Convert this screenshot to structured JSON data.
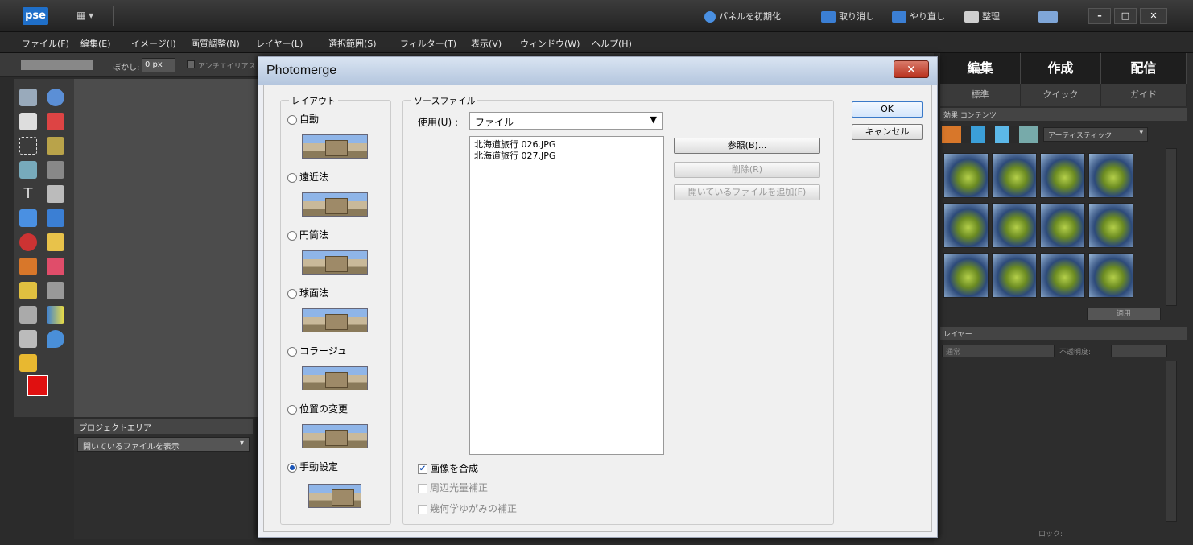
{
  "titlebar": {
    "logo": "pse",
    "view": "▦ ▾",
    "reset_panels": "パネルを初期化",
    "undo": "取り消し",
    "redo": "やり直し",
    "organize": "整理",
    "min": "–",
    "max": "□",
    "close": "✕"
  },
  "menubar": {
    "items": [
      "ファイル(F)",
      "編集(E)",
      "イメージ(I)",
      "画質調整(N)",
      "レイヤー(L)",
      "選択範囲(S)",
      "フィルター(T)",
      "表示(V)",
      "ウィンドウ(W)",
      "ヘルプ(H)"
    ]
  },
  "optbar": {
    "blur_label": "ぼかし:",
    "blur_value": "0 px",
    "antialias": "アンチエイリアス"
  },
  "project": {
    "title": "プロジェクトエリア",
    "select": "開いているファイルを表示"
  },
  "rightpanel": {
    "tabs": [
      "編集",
      "作成",
      "配信"
    ],
    "subtabs": [
      "標準",
      "クイック",
      "ガイド"
    ],
    "effects_header": "効果  コンテンツ",
    "effects_select": "アーティスティック",
    "apply": "適用",
    "layers_header": "レイヤー",
    "blend": "通常",
    "opacity": "不透明度:",
    "lock": "ロック:"
  },
  "dialog": {
    "title": "Photomerge",
    "close": "✕",
    "layout_label": "レイアウト",
    "layouts": [
      "自動",
      "遠近法",
      "円筒法",
      "球面法",
      "コラージュ",
      "位置の変更",
      "手動設定"
    ],
    "selected_layout": "手動設定",
    "source_label": "ソースファイル",
    "use_label": "使用(U) :",
    "use_value": "ファイル",
    "files": [
      "北海道旅行 026.JPG",
      "北海道旅行 027.JPG"
    ],
    "browse": "参照(B)...",
    "remove": "削除(R)",
    "add_open": "開いているファイルを追加(F)",
    "ok": "OK",
    "cancel": "キャンセル",
    "options": [
      {
        "label": "画像を合成",
        "checked": true,
        "enabled": true
      },
      {
        "label": "周辺光量補正",
        "checked": false,
        "enabled": false
      },
      {
        "label": "幾何学ゆがみの補正",
        "checked": false,
        "enabled": false
      }
    ]
  },
  "colors": {
    "foreground": "#e01010",
    "background": "#000000",
    "accent": "#1f6fc9"
  }
}
